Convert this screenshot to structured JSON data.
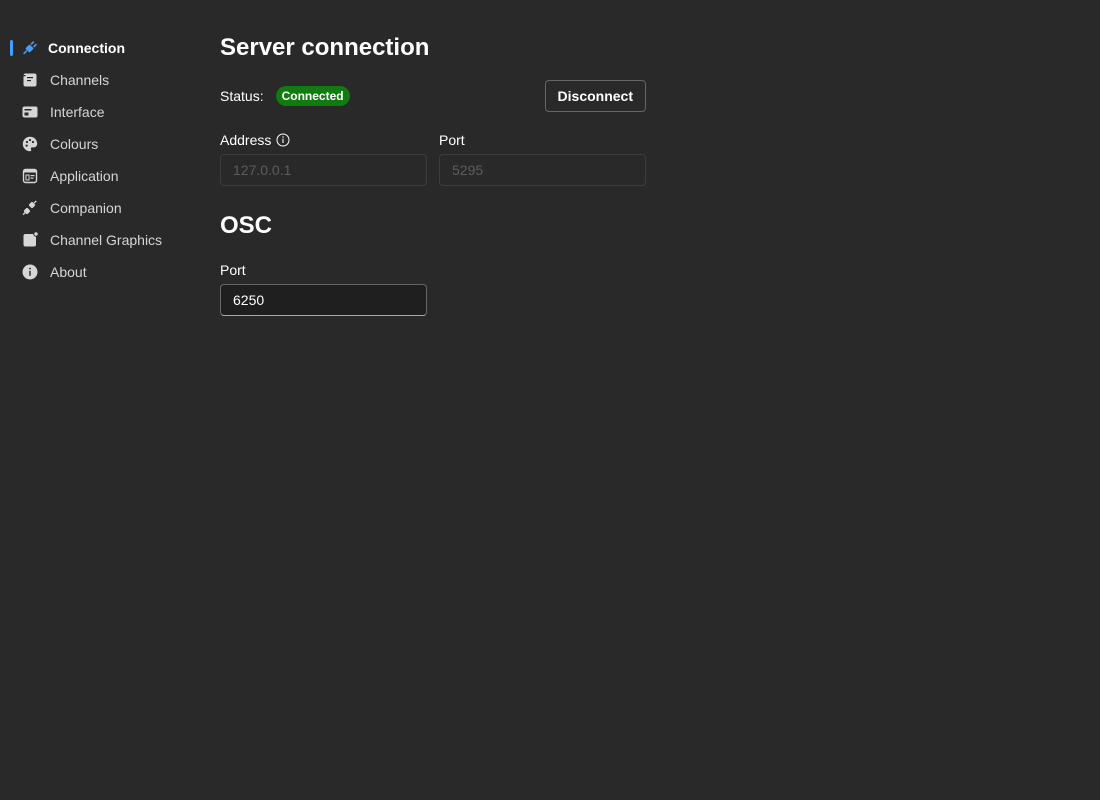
{
  "sidebar": {
    "items": [
      {
        "label": "Connection",
        "icon": "plug-connected-icon",
        "active": true
      },
      {
        "label": "Channels",
        "icon": "channels-icon"
      },
      {
        "label": "Interface",
        "icon": "interface-icon"
      },
      {
        "label": "Colours",
        "icon": "palette-icon"
      },
      {
        "label": "Application",
        "icon": "application-icon"
      },
      {
        "label": "Companion",
        "icon": "plug-disconnected-icon"
      },
      {
        "label": "Channel Graphics",
        "icon": "channel-graphics-icon"
      },
      {
        "label": "About",
        "icon": "info-icon"
      }
    ]
  },
  "server": {
    "title": "Server connection",
    "status_label": "Status:",
    "status_value": "Connected",
    "disconnect_label": "Disconnect",
    "address_label": "Address",
    "address_placeholder": "127.0.0.1",
    "port_label": "Port",
    "port_placeholder": "5295"
  },
  "osc": {
    "title": "OSC",
    "port_label": "Port",
    "port_value": "6250"
  },
  "colors": {
    "accent": "#479ef5",
    "status_connected": "#107c10",
    "background": "#292929"
  }
}
